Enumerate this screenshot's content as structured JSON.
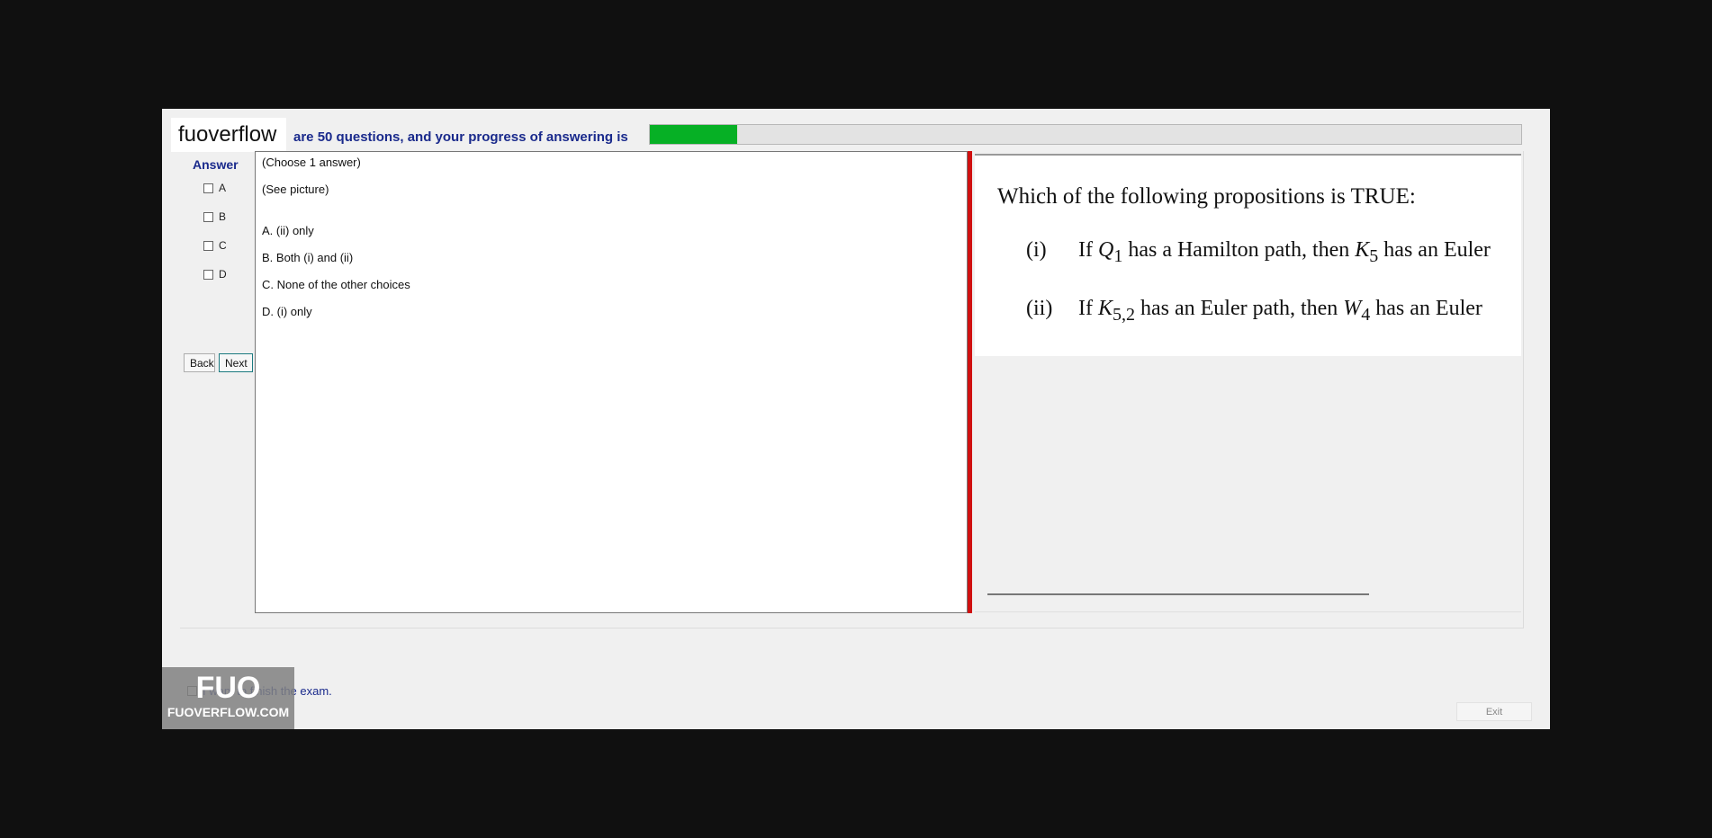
{
  "header": {
    "brand": "fuoverflow",
    "progress_text": "are 50 questions, and your progress of answering is",
    "progress_fraction": 0.1
  },
  "answer": {
    "label": "Answer",
    "options": [
      "A",
      "B",
      "C",
      "D"
    ]
  },
  "nav": {
    "back_label": "Back",
    "next_label": "Next"
  },
  "question_text": {
    "instruction": "(Choose 1 answer)",
    "see_picture": "(See picture)",
    "choices": [
      "A.  (ii) only",
      "B.  Both (i) and (ii)",
      "C.  None of the other choices",
      "D.  (i) only"
    ]
  },
  "question_image": {
    "title": "Which of the following propositions is TRUE:",
    "props": [
      {
        "num": "(i)",
        "text_html": "If <i>Q</i><sub>1</sub> has a Hamilton path, then <i>K</i><sub>5</sub> has an Euler"
      },
      {
        "num": "(ii)",
        "text_html": "If <i>K</i><sub>5,2</sub> has an Euler path, then <i>W</i><sub>4</sub> has an Euler"
      }
    ]
  },
  "footer": {
    "finish_label": "I want to finish the exam.",
    "badge_line1": "FUO",
    "badge_line2": "FUOVERFLOW.COM",
    "exit_label": "Exit"
  },
  "colors": {
    "accent": "#1a2a8c",
    "progress": "#06b025",
    "divider": "#d01010"
  }
}
